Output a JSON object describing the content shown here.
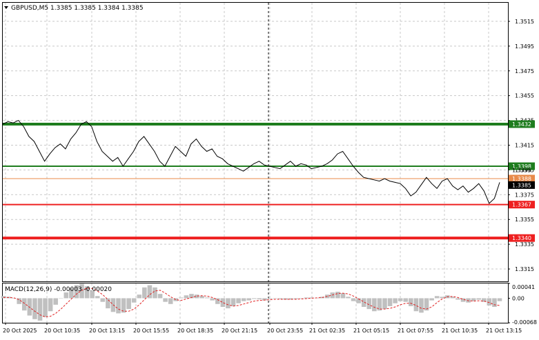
{
  "chart_data": [
    {
      "type": "line",
      "title": "GBPUSD,M5  1.3385 1.3385 1.3384 1.3385",
      "symbol": "GBPUSD,M5",
      "ohlc": [
        "1.3385",
        "1.3385",
        "1.3384",
        "1.3385"
      ],
      "ylim": [
        1.3305,
        1.353
      ],
      "y_ticks": [
        "1.3515",
        "1.3495",
        "1.3475",
        "1.3455",
        "1.3435",
        "1.3415",
        "1.3395",
        "1.3375",
        "1.3355",
        "1.3335",
        "1.3315"
      ],
      "x_ticks": [
        "20 Oct 2025",
        "20 Oct 10:35",
        "20 Oct 13:15",
        "20 Oct 15:55",
        "20 Oct 18:35",
        "20 Oct 21:15",
        "20 Oct 23:55",
        "21 Oct 02:35",
        "21 Oct 05:15",
        "21 Oct 07:55",
        "21 Oct 10:35",
        "21 Oct 13:15"
      ],
      "grid": true,
      "series": [
        {
          "values": [
            1.3432,
            1.3434,
            1.3433,
            1.3435,
            1.343,
            1.3422,
            1.3418,
            1.341,
            1.3402,
            1.3408,
            1.3413,
            1.3416,
            1.3412,
            1.342,
            1.3425,
            1.3432,
            1.3434,
            1.343,
            1.3418,
            1.341,
            1.3406,
            1.3402,
            1.3405,
            1.3398,
            1.3404,
            1.341,
            1.3418,
            1.3422,
            1.3416,
            1.341,
            1.3402,
            1.3398,
            1.3406,
            1.3414,
            1.341,
            1.3406,
            1.3416,
            1.342,
            1.3414,
            1.341,
            1.3412,
            1.3406,
            1.3404,
            1.34,
            1.3398,
            1.3396,
            1.3394,
            1.3397,
            1.34,
            1.3402,
            1.3399,
            1.3398,
            1.3397,
            1.3396,
            1.3399,
            1.3402,
            1.3398,
            1.34,
            1.3399,
            1.3396,
            1.3397,
            1.3398,
            1.34,
            1.3403,
            1.3408,
            1.341,
            1.3404,
            1.3398,
            1.3393,
            1.3389,
            1.3388,
            1.3387,
            1.3386,
            1.3388,
            1.3386,
            1.3385,
            1.3384,
            1.338,
            1.3374,
            1.3377,
            1.3383,
            1.3389,
            1.3384,
            1.338,
            1.3386,
            1.3388,
            1.3382,
            1.3379,
            1.3382,
            1.3377,
            1.338,
            1.3384,
            1.3378,
            1.3368,
            1.3372,
            1.3385
          ]
        }
      ],
      "levels": [
        {
          "value": 1.3432,
          "label": "1.3432",
          "color": "#1e7d1e",
          "weight": "thick"
        },
        {
          "value": 1.3398,
          "label": "1.3398",
          "color": "#1e7d1e",
          "weight": "thin"
        },
        {
          "value": 1.3388,
          "label": "1.3388",
          "color": "#e88a4a",
          "weight": "hair"
        },
        {
          "value": 1.3367,
          "label": "1.3367",
          "color": "#ee2020",
          "weight": "thin"
        },
        {
          "value": 1.334,
          "label": "1.3340",
          "color": "#ee2020",
          "weight": "thick"
        }
      ],
      "current_price": {
        "value": 1.3385,
        "label": "1.3385",
        "color": "#000000"
      },
      "hidden_label": "1.3395",
      "colors": {
        "price_line": "#000000",
        "grid": "#c8c8c8",
        "axis_text": "#000000"
      }
    },
    {
      "type": "bar",
      "title": "MACD(12,26,9) -0.00003 -0.00020",
      "ylim": [
        -0.00068,
        0.00041
      ],
      "y_ticks": [
        "0.00041",
        "0.00",
        "-0.00068"
      ],
      "series": [
        {
          "name": "MACD",
          "color": "#c0c0c0",
          "values": [
            6e-05,
            4e-05,
            0.0,
            -0.00016,
            -0.00034,
            -0.00048,
            -0.00058,
            -0.00062,
            -0.00052,
            -0.00036,
            -0.00018,
            0.0,
            0.00016,
            0.00028,
            0.00036,
            0.0004,
            0.00033,
            0.0002,
            6e-05,
            -0.0001,
            -0.00028,
            -0.00038,
            -0.00042,
            -0.0004,
            -0.0003,
            -0.00012,
            0.0001,
            0.0003,
            0.00036,
            0.0003,
            0.00012,
            -0.0001,
            -0.00016,
            -8e-05,
            2e-05,
            8e-05,
            0.00012,
            0.0001,
            6e-05,
            2e-05,
            -6e-05,
            -0.00016,
            -0.00024,
            -0.00028,
            -0.00022,
            -0.00014,
            -8e-05,
            -6e-05,
            -2e-05,
            -3e-05,
            -6e-05,
            -2e-05,
            0.0,
            -2e-05,
            -4e-05,
            -4e-05,
            -2e-05,
            0.0,
            2e-05,
            2e-05,
            1e-05,
            4e-05,
            0.0001,
            0.00016,
            0.00018,
            0.00014,
            4e-05,
            -8e-05,
            -0.00014,
            -0.00024,
            -0.0003,
            -0.00036,
            -0.00034,
            -0.0003,
            -0.00022,
            -0.00014,
            -8e-05,
            -0.0001,
            -0.00022,
            -0.00036,
            -0.0004,
            -0.00034,
            -6e-05,
            6e-05,
            4e-05,
            8e-05,
            4e-05,
            -4e-05,
            -0.0001,
            -0.00012,
            -8e-05,
            -4e-05,
            -0.0001,
            -0.0002,
            -0.00024,
            -8e-05
          ]
        },
        {
          "name": "Signal",
          "color": "#e02020",
          "style": "dashed",
          "values": [
            2e-05,
            2e-05,
            1e-05,
            -4e-05,
            -0.00014,
            -0.00025,
            -0.00036,
            -0.00046,
            -0.00052,
            -0.0005,
            -0.00042,
            -0.0003,
            -0.00016,
            -2e-05,
            0.00012,
            0.00022,
            0.00028,
            0.00027,
            0.0002,
            0.0001,
            -4e-05,
            -0.00018,
            -0.0003,
            -0.00036,
            -0.00036,
            -0.0003,
            -0.00018,
            -4e-05,
            0.0001,
            0.0002,
            0.00022,
            0.00014,
            4e-05,
            -4e-05,
            -6e-05,
            -2e-05,
            2e-05,
            6e-05,
            7e-05,
            6e-05,
            2e-05,
            -4e-05,
            -0.00012,
            -0.00018,
            -0.00022,
            -0.0002,
            -0.00016,
            -0.00012,
            -8e-05,
            -6e-05,
            -5e-05,
            -4e-05,
            -3e-05,
            -3e-05,
            -3e-05,
            -3e-05,
            -3e-05,
            -2e-05,
            -1e-05,
            0.0,
            1e-05,
            2e-05,
            5e-05,
            9e-05,
            0.00013,
            0.00014,
            0.00012,
            6e-05,
            -2e-05,
            -0.0001,
            -0.00018,
            -0.00025,
            -0.0003,
            -0.0003,
            -0.00028,
            -0.00024,
            -0.00018,
            -0.00014,
            -0.00014,
            -0.0002,
            -0.00028,
            -0.0003,
            -0.00024,
            -0.00012,
            -2e-05,
            4e-05,
            5e-05,
            2e-05,
            -3e-05,
            -7e-05,
            -8e-05,
            -7e-05,
            -8e-05,
            -0.00012,
            -0.00018,
            -0.0002
          ]
        }
      ]
    }
  ]
}
